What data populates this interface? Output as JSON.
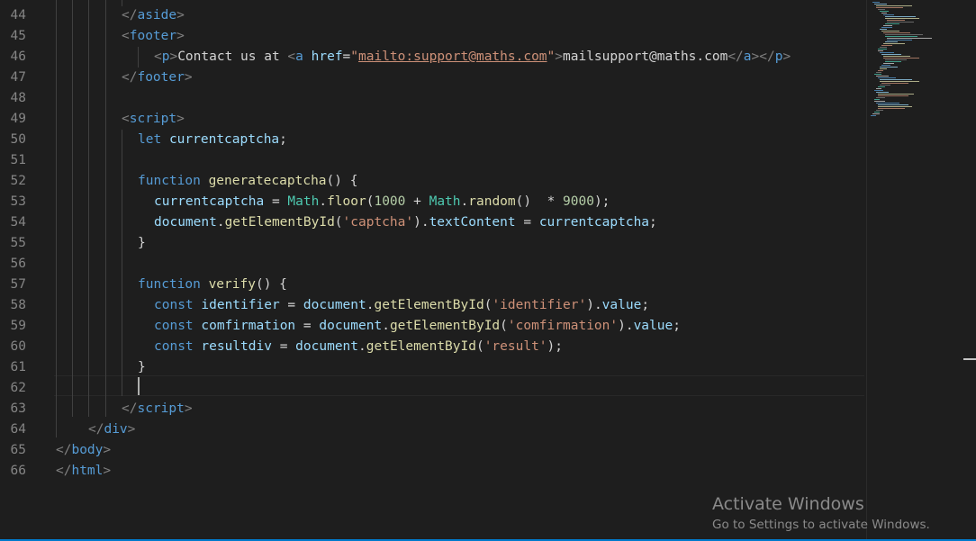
{
  "editor": {
    "line_numbers": [
      "44",
      "45",
      "46",
      "47",
      "48",
      "49",
      "50",
      "51",
      "52",
      "53",
      "54",
      "55",
      "56",
      "57",
      "58",
      "59",
      "60",
      "61",
      "62",
      "63",
      "64",
      "65",
      "66"
    ],
    "cursor_line": "62"
  },
  "code": {
    "l44": {
      "open": "</",
      "tag": "aside",
      "close": ">"
    },
    "l45": {
      "open": "<",
      "tag": "footer",
      "close": ">"
    },
    "l46": {
      "p_open": "<",
      "p_tag": "p",
      "p_close": ">",
      "text": "Contact us at ",
      "a_open": "<",
      "a_tag": "a",
      "attr": "href",
      "eq": "=",
      "q1": "\"",
      "href": "mailto:support@maths.com",
      "q2": "\"",
      "a_close": ">",
      "link_text": "mailsupport@maths.com",
      "a_end_open": "</",
      "a_end_tag": "a",
      "a_end_close": ">",
      "p_end_open": "</",
      "p_end_tag": "p",
      "p_end_close": ">"
    },
    "l47": {
      "open": "</",
      "tag": "footer",
      "close": ">"
    },
    "l49": {
      "open": "<",
      "tag": "script",
      "close": ">"
    },
    "l50": {
      "kw": "let",
      "var": "currentcaptcha",
      "end": ";"
    },
    "l52": {
      "kw": "function",
      "fn": "generatecaptcha",
      "rest": "() {"
    },
    "l53": {
      "var": "currentcaptcha",
      "op": " = ",
      "cls1": "Math",
      "dot1": ".",
      "fn1": "floor",
      "p1": "(",
      "num1": "1000",
      "plus": " + ",
      "cls2": "Math",
      "dot2": ".",
      "fn2": "random",
      "p2": "()",
      "mul": "  * ",
      "num2": "9000",
      "end": ");"
    },
    "l54": {
      "var1": "document",
      "dot1": ".",
      "fn": "getElementById",
      "p1": "(",
      "str": "'captcha'",
      "p2": ")",
      "dot2": ".",
      "prop": "textContent",
      "op": " = ",
      "var2": "currentcaptcha",
      "end": ";"
    },
    "l55": {
      "brace": "}"
    },
    "l57": {
      "kw": "function",
      "fn": "verify",
      "rest": "() {"
    },
    "l58": {
      "kw": "const",
      "var": "identifier",
      "op": " = ",
      "obj": "document",
      "dot1": ".",
      "fn": "getElementById",
      "p1": "(",
      "str": "'identifier'",
      "p2": ")",
      "dot2": ".",
      "prop": "value",
      "end": ";"
    },
    "l59": {
      "kw": "const",
      "var": "comfirmation",
      "op": " = ",
      "obj": "document",
      "dot1": ".",
      "fn": "getElementById",
      "p1": "(",
      "str": "'comfirmation'",
      "p2": ")",
      "dot2": ".",
      "prop": "value",
      "end": ";"
    },
    "l60": {
      "kw": "const",
      "var": "resultdiv",
      "op": " = ",
      "obj": "document",
      "dot1": ".",
      "fn": "getElementById",
      "p1": "(",
      "str": "'result'",
      "end": ");"
    },
    "l61": {
      "brace": "}"
    },
    "l63": {
      "open": "</",
      "tag": "script",
      "close": ">"
    },
    "l64": {
      "open": "</",
      "tag": "div",
      "close": ">"
    },
    "l65": {
      "open": "</",
      "tag": "body",
      "close": ">"
    },
    "l66": {
      "open": "</",
      "tag": "html",
      "close": ">"
    }
  },
  "watermark": {
    "title": "Activate Windows",
    "subtitle": "Go to Settings to activate Windows."
  },
  "colors": {
    "background": "#1e1e1e",
    "tag": "#569cd6",
    "string": "#ce9178",
    "variable": "#9cdcfe",
    "function": "#dcdcaa",
    "class": "#4ec9b0",
    "number": "#b5cea8",
    "accent": "#007acc"
  }
}
